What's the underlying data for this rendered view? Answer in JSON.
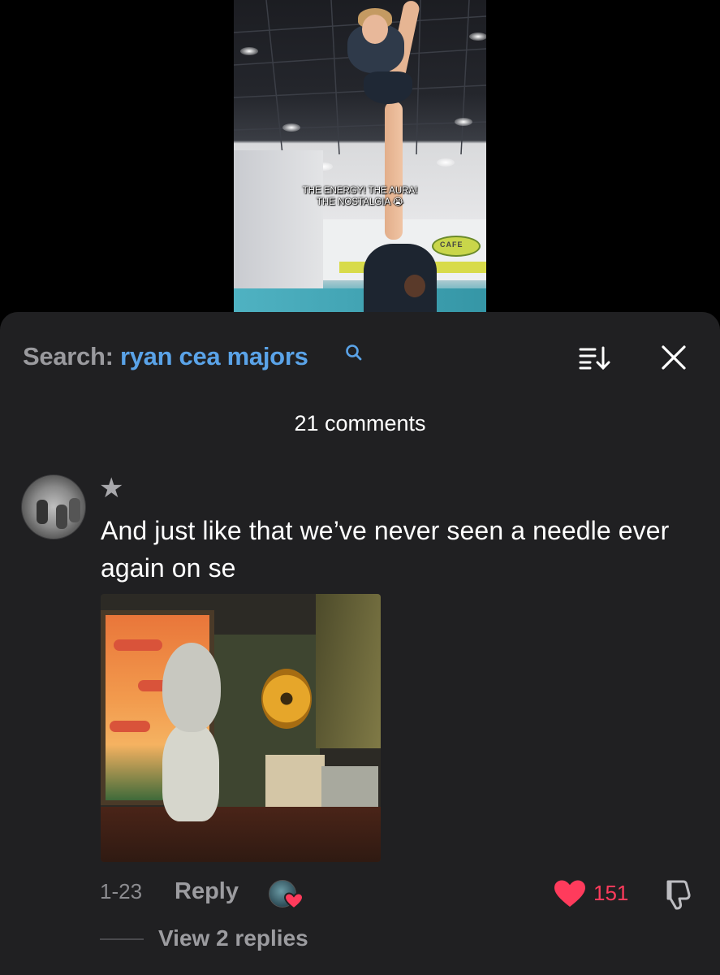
{
  "video": {
    "caption_line1": "THE ENERGY! THE AURA!",
    "caption_line2": "THE NOSTALGIA",
    "caption_emoji": "😭",
    "sign_text": "CAFE"
  },
  "search": {
    "label": "Search: ",
    "query": "ryan cea majors"
  },
  "header": {
    "comments_count": "21 comments"
  },
  "comment": {
    "badge": "★",
    "text": "And just like that we’ve never seen a needle ever again on se",
    "date": "1-23",
    "reply_label": "Reply",
    "like_count": "151",
    "view_replies": "View 2 replies"
  },
  "icons": {
    "search": "search-icon",
    "sort": "sort-icon",
    "close": "close-icon",
    "like": "heart-icon",
    "dislike": "thumbs-down-icon"
  },
  "colors": {
    "panel_bg": "#202022",
    "search_query": "#5aa3e8",
    "like": "#ff3b5c",
    "muted_text": "#9c9ca0"
  }
}
